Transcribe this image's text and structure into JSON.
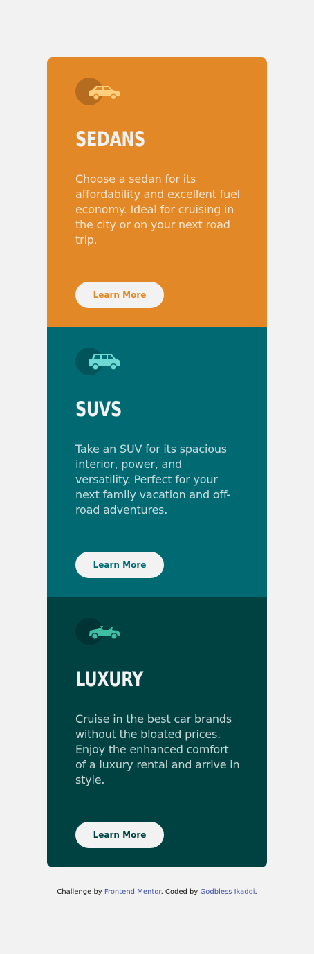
{
  "cards": [
    {
      "icon": "sedan-car-icon",
      "title": "Sedans",
      "title_display": "SEDANS",
      "description": "Choose a sedan for its affordability and excellent fuel economy. Ideal for cruising in the city or on your next road trip.",
      "button_label": "Learn More",
      "color": "#e38826"
    },
    {
      "icon": "suv-car-icon",
      "title": "SUVs",
      "title_display": "SUVS",
      "description": "Take an SUV for its spacious interior, power, and versatility. Perfect for your next family vacation and off-road adventures.",
      "button_label": "Learn More",
      "color": "#006971"
    },
    {
      "icon": "luxury-car-icon",
      "title": "Luxury",
      "title_display": "LUXURY",
      "description": "Cruise in the best car brands without the bloated prices. Enjoy the enhanced comfort of a luxury rental and arrive in style.",
      "button_label": "Learn More",
      "color": "#004241"
    }
  ],
  "attribution": {
    "prefix": "Challenge by ",
    "challenge_link": "Frontend Mentor",
    "middle": ". Coded by ",
    "author_link": "Godbless Ikadoi",
    "suffix": "."
  },
  "colors": {
    "background": "#f2f2f2",
    "link": "#3e52a3",
    "sedan_icon": "#ffd17f",
    "suv_icon": "#6dd9d2",
    "luxury_icon": "#3fbea3"
  }
}
